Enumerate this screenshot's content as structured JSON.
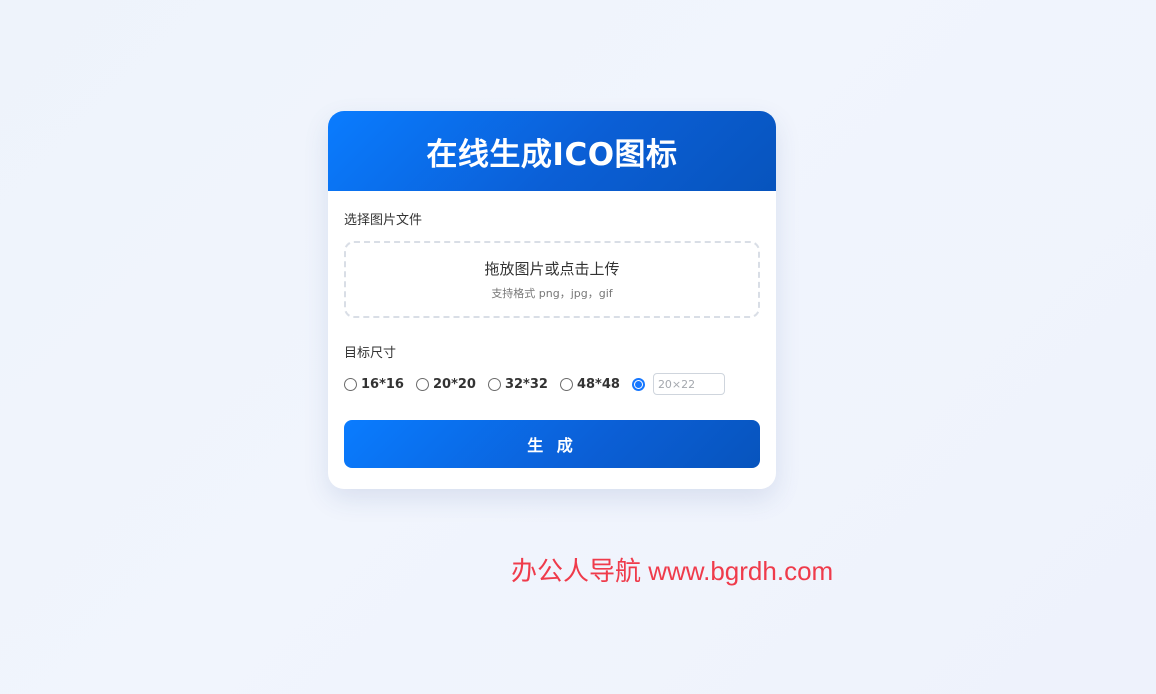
{
  "card": {
    "title": "在线生成ICO图标",
    "file_label": "选择图片文件",
    "dropzone": {
      "title": "拖放图片或点击上传",
      "subtitle": "支持格式 png，jpg，gif"
    },
    "sizes_label": "目标尺寸",
    "size_options": [
      "16*16",
      "20*20",
      "32*32",
      "48*48"
    ],
    "selected_option": "custom",
    "custom_size_placeholder": "20×22",
    "generate_label": "生 成"
  },
  "watermark": "办公人导航 www.bgrdh.com",
  "colors": {
    "accent": "#0a7cff",
    "accent_dark": "#0754bd",
    "watermark": "#ef3b4b"
  },
  "icons": {
    "radio": "radio-icon"
  }
}
